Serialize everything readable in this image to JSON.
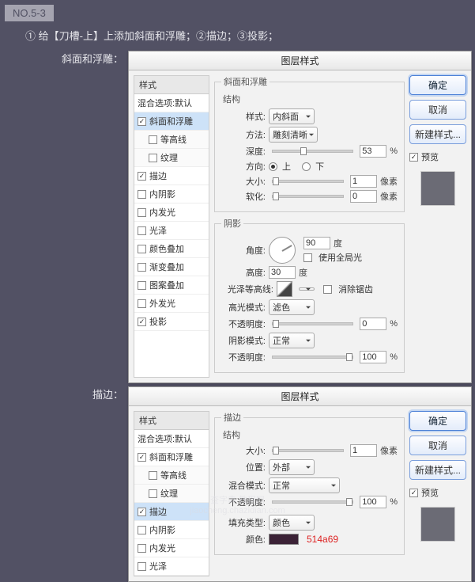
{
  "step_badge": "NO.5-3",
  "instructions": "① 给【刀槽-上】上添加斜面和浮雕；②描边；③投影；",
  "section_labels": {
    "bevel": "斜面和浮雕：",
    "stroke": "描边："
  },
  "dialog_title": "图层样式",
  "styles_panel": {
    "header": "样式",
    "blend_default": "混合选项:默认",
    "items": [
      {
        "label": "斜面和浮雕",
        "checked": true,
        "selected_bevel": true
      },
      {
        "label": "等高线",
        "checked": false,
        "sub": true
      },
      {
        "label": "纹理",
        "checked": false,
        "sub": true
      },
      {
        "label": "描边",
        "checked": true,
        "selected_stroke": true
      },
      {
        "label": "内阴影",
        "checked": false
      },
      {
        "label": "内发光",
        "checked": false
      },
      {
        "label": "光泽",
        "checked": false
      },
      {
        "label": "颜色叠加",
        "checked": false
      },
      {
        "label": "渐变叠加",
        "checked": false
      },
      {
        "label": "图案叠加",
        "checked": false
      },
      {
        "label": "外发光",
        "checked": false
      },
      {
        "label": "投影",
        "checked": true
      }
    ],
    "items_stroke_count": 8
  },
  "bevel": {
    "group": "斜面和浮雕",
    "structure": "结构",
    "style_label": "样式:",
    "style_value": "内斜面",
    "method_label": "方法:",
    "method_value": "雕刻清晰",
    "depth_label": "深度:",
    "depth_value": "53",
    "depth_unit": "%",
    "direction_label": "方向:",
    "dir_up": "上",
    "dir_down": "下",
    "size_label": "大小:",
    "size_value": "1",
    "size_unit": "像素",
    "soften_label": "软化:",
    "soften_value": "0",
    "soften_unit": "像素",
    "shading": "阴影",
    "angle_label": "角度:",
    "angle_value": "90",
    "angle_unit": "度",
    "global_light": "使用全局光",
    "altitude_label": "高度:",
    "altitude_value": "30",
    "altitude_unit": "度",
    "gloss_label": "光泽等高线:",
    "antialias": "消除锯齿",
    "highlight_mode_label": "高光模式:",
    "highlight_mode_value": "滤色",
    "opacity_label": "不透明度:",
    "highlight_opacity": "0",
    "opacity_unit": "%",
    "shadow_mode_label": "阴影模式:",
    "shadow_mode_value": "正常",
    "shadow_opacity": "100"
  },
  "stroke": {
    "group": "描边",
    "structure": "结构",
    "size_label": "大小:",
    "size_value": "1",
    "size_unit": "像素",
    "position_label": "位置:",
    "position_value": "外部",
    "blend_label": "混合模式:",
    "blend_value": "正常",
    "opacity_label": "不透明度:",
    "opacity_value": "100",
    "opacity_unit": "%",
    "fill_type_label": "填充类型:",
    "fill_type_value": "颜色",
    "color_label": "颜色:",
    "color_hex": "514a69"
  },
  "buttons": {
    "ok": "确定",
    "cancel": "取消",
    "new_style": "新建样式...",
    "preview": "预览"
  },
  "watermark": "查字典   教程网",
  "watermark_url": "jiaocheng.chazidian.com"
}
